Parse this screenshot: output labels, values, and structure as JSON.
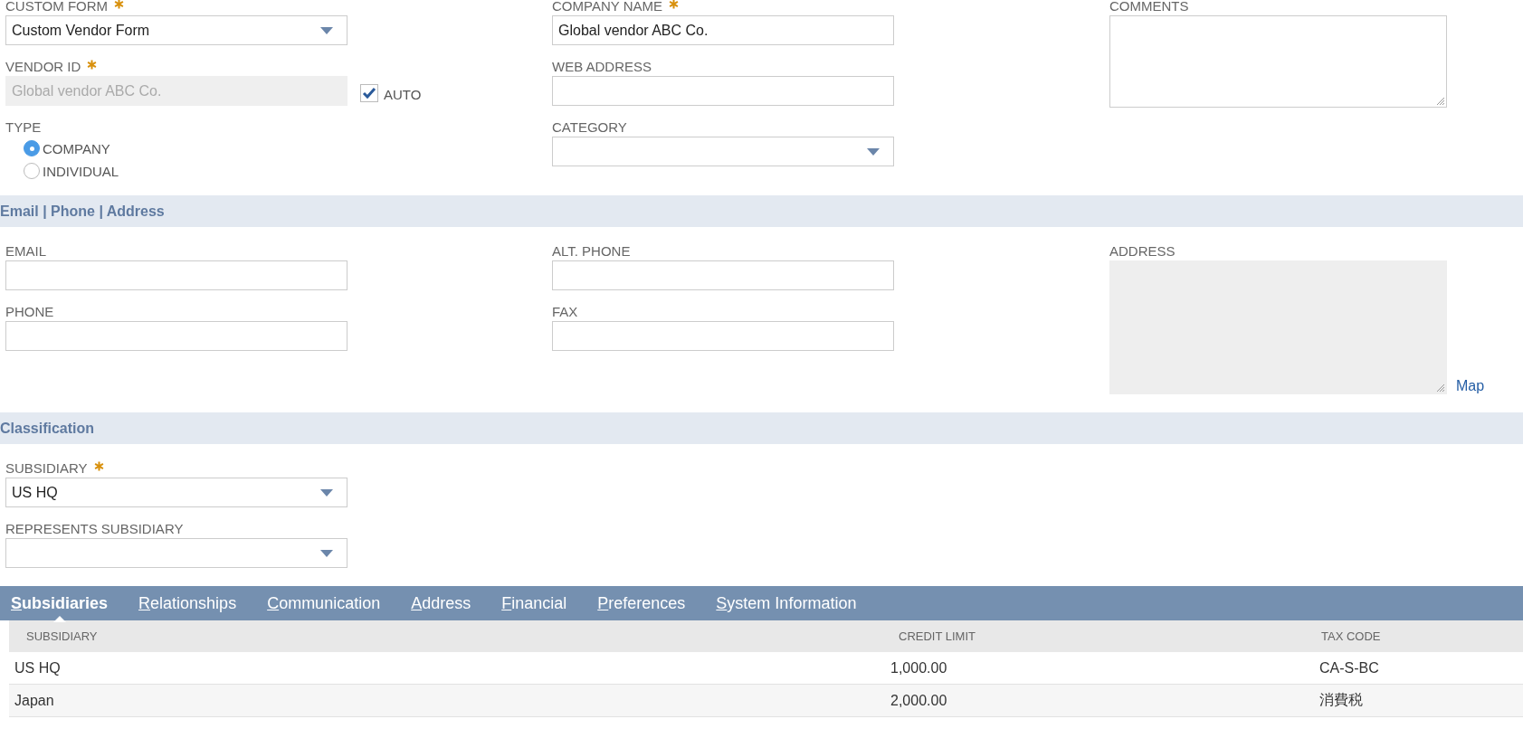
{
  "sections": [
    {
      "columns": [
        [
          {
            "kind": "select",
            "label": "CUSTOM FORM",
            "required": true,
            "value": "Custom Vendor Form"
          },
          {
            "kind": "text",
            "label": "VENDOR ID",
            "required": true,
            "value": "Global vendor ABC Co.",
            "disabled": true,
            "checkbox": {
              "label": "AUTO",
              "checked": true
            }
          },
          {
            "kind": "radio",
            "label": "TYPE",
            "options": [
              {
                "label": "COMPANY",
                "selected": true
              },
              {
                "label": "INDIVIDUAL",
                "selected": false
              }
            ]
          }
        ],
        [
          {
            "kind": "text",
            "label": "COMPANY NAME",
            "required": true,
            "value": "Global vendor ABC Co."
          },
          {
            "kind": "text",
            "label": "WEB ADDRESS"
          },
          {
            "kind": "select",
            "label": "CATEGORY"
          }
        ],
        [
          {
            "kind": "textarea",
            "label": "COMMENTS"
          }
        ]
      ]
    },
    {
      "title": "Email | Phone | Address",
      "columns": [
        [
          {
            "kind": "text",
            "label": "EMAIL"
          },
          {
            "kind": "text",
            "label": "PHONE"
          }
        ],
        [
          {
            "kind": "text",
            "label": "ALT. PHONE"
          },
          {
            "kind": "text",
            "label": "FAX"
          }
        ],
        [
          {
            "kind": "textarea",
            "label": "ADDRESS",
            "disabled": true,
            "link": "Map"
          }
        ]
      ]
    },
    {
      "title": "Classification",
      "columns": [
        [
          {
            "kind": "select",
            "label": "SUBSIDIARY",
            "required": true,
            "value": "US HQ"
          },
          {
            "kind": "select",
            "label": "REPRESENTS SUBSIDIARY"
          }
        ]
      ]
    }
  ],
  "tabs": [
    {
      "label": "Subsidiaries",
      "selected": true
    },
    {
      "label": "Relationships",
      "selected": false
    },
    {
      "label": "Communication",
      "selected": false
    },
    {
      "label": "Address",
      "selected": false
    },
    {
      "label": "Financial",
      "selected": false
    },
    {
      "label": "Preferences",
      "selected": false
    },
    {
      "label": "System Information",
      "selected": false
    }
  ],
  "table": {
    "columns": [
      "SUBSIDIARY",
      "CREDIT LIMIT",
      "TAX CODE"
    ],
    "rows": [
      [
        "US HQ",
        "1,000.00",
        "CA-S-BC"
      ],
      [
        "Japan",
        "2,000.00",
        "消費税"
      ]
    ]
  }
}
